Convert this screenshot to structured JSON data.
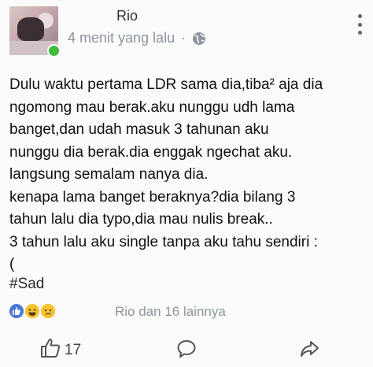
{
  "post": {
    "author": "Rio",
    "time": "4 menit yang lalu",
    "separator": "·",
    "lines": [
      "Dulu waktu pertama LDR sama dia,tiba² aja dia",
      "ngomong mau berak.aku nunggu udh lama",
      "banget,dan udah masuk 3 tahunan aku",
      "nunggu dia berak.dia enggak ngechat aku.",
      "langsung semalam nanya dia.",
      "kenapa lama banget beraknya?dia bilang 3",
      "tahun lalu dia typo,dia mau nulis break..",
      "3 tahun lalu aku single tanpa aku tahu sendiri :",
      "("
    ],
    "hashtag": "#Sad",
    "reactions": {
      "icons": [
        "like-icon",
        "haha-icon",
        "sad-icon"
      ],
      "names": "Rio dan 16 lainnya"
    },
    "actions": {
      "like_count": "17",
      "icons": [
        "thumbs-up-icon",
        "comment-icon",
        "share-icon"
      ]
    },
    "colors": {
      "like_blue": "#4a76d6",
      "online_green": "#3fbb3f",
      "meta_gray": "#8d949e"
    }
  }
}
